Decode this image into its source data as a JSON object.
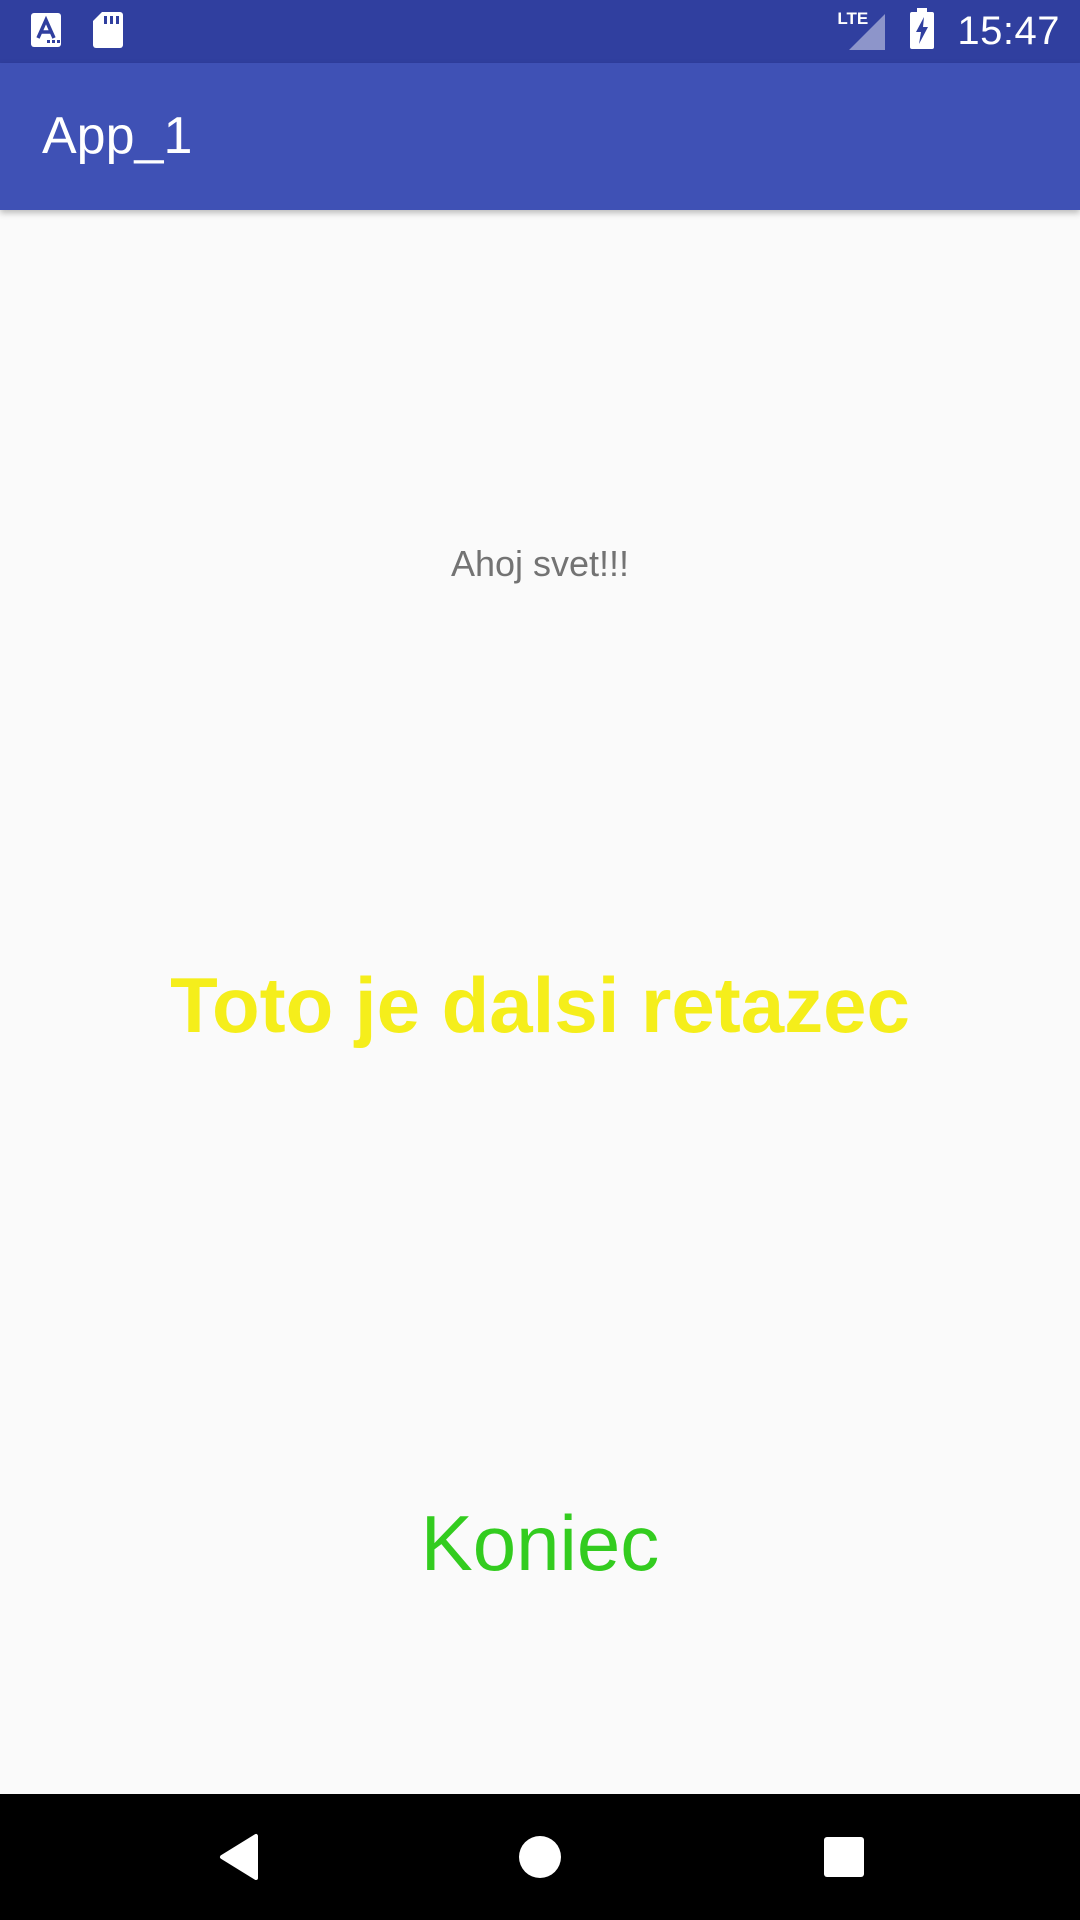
{
  "status_bar": {
    "time": "15:47",
    "network_label": "LTE",
    "icons": [
      "app-notification-icon",
      "sd-card-icon",
      "lte-signal-icon",
      "battery-charging-icon"
    ],
    "background_color": "#303f9f"
  },
  "app_bar": {
    "title": "App_1",
    "background_color": "#3f51b5"
  },
  "content": {
    "greeting": "Ahoj svet!!!",
    "second_text": "Toto je dalsi retazec",
    "second_text_color": "#f5ee1b",
    "end_text": "Koniec",
    "end_text_color": "#33cc1f"
  },
  "nav_bar": {
    "buttons": [
      "back-icon",
      "home-icon",
      "recents-icon"
    ]
  }
}
